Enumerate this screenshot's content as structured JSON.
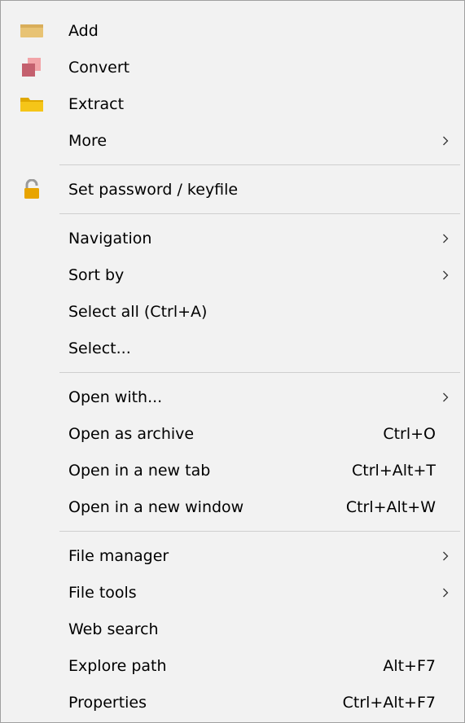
{
  "menu": {
    "groups": [
      {
        "items": [
          {
            "label": "Add",
            "icon": "archive-box-icon",
            "submenu": false
          },
          {
            "label": "Convert",
            "icon": "convert-icon",
            "submenu": false
          },
          {
            "label": "Extract",
            "icon": "folder-icon",
            "submenu": false
          },
          {
            "label": "More",
            "icon": "",
            "submenu": true
          }
        ]
      },
      {
        "items": [
          {
            "label": "Set password / keyfile",
            "icon": "padlock-icon",
            "submenu": false
          }
        ]
      },
      {
        "items": [
          {
            "label": "Navigation",
            "submenu": true
          },
          {
            "label": "Sort by",
            "submenu": true
          },
          {
            "label": "Select all (Ctrl+A)",
            "submenu": false
          },
          {
            "label": "Select...",
            "submenu": false
          }
        ]
      },
      {
        "items": [
          {
            "label": "Open with...",
            "submenu": true
          },
          {
            "label": "Open as archive",
            "shortcut": "Ctrl+O",
            "submenu": false
          },
          {
            "label": "Open in a new tab",
            "shortcut": "Ctrl+Alt+T",
            "submenu": false
          },
          {
            "label": "Open in a new window",
            "shortcut": "Ctrl+Alt+W",
            "submenu": false
          }
        ]
      },
      {
        "items": [
          {
            "label": "File manager",
            "submenu": true
          },
          {
            "label": "File tools",
            "submenu": true
          },
          {
            "label": "Web search",
            "submenu": false
          },
          {
            "label": "Explore path",
            "shortcut": "Alt+F7",
            "submenu": false
          },
          {
            "label": "Properties",
            "shortcut": "Ctrl+Alt+F7",
            "submenu": false
          }
        ]
      }
    ]
  },
  "colors": {
    "menu_background": "#f2f2f2",
    "border": "#a0a0a0",
    "separator": "#cfcfcf",
    "archive_box": "#e8c374",
    "convert_back": "#f2a4a8",
    "convert_front": "#c4606e",
    "folder": "#f5c518",
    "padlock": "#e8a400"
  }
}
